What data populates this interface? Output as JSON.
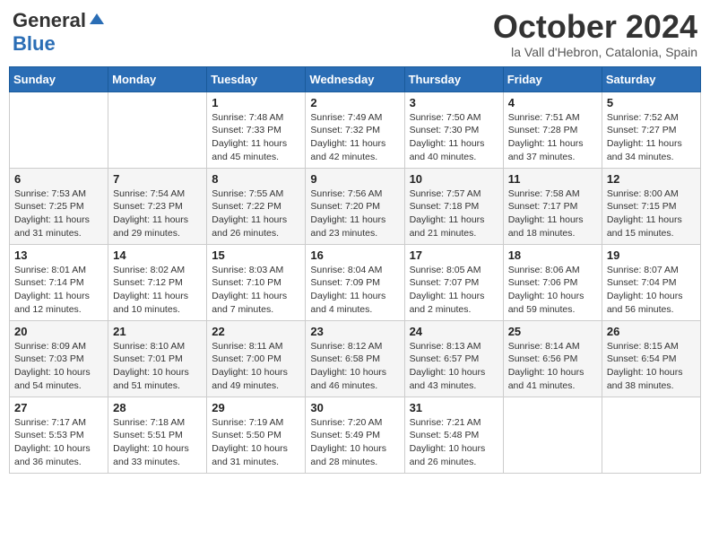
{
  "logo": {
    "general": "General",
    "blue": "Blue"
  },
  "title": "October 2024",
  "location": "la Vall d'Hebron, Catalonia, Spain",
  "headers": [
    "Sunday",
    "Monday",
    "Tuesday",
    "Wednesday",
    "Thursday",
    "Friday",
    "Saturday"
  ],
  "weeks": [
    [
      {
        "day": "",
        "info": ""
      },
      {
        "day": "",
        "info": ""
      },
      {
        "day": "1",
        "info": "Sunrise: 7:48 AM\nSunset: 7:33 PM\nDaylight: 11 hours and 45 minutes."
      },
      {
        "day": "2",
        "info": "Sunrise: 7:49 AM\nSunset: 7:32 PM\nDaylight: 11 hours and 42 minutes."
      },
      {
        "day": "3",
        "info": "Sunrise: 7:50 AM\nSunset: 7:30 PM\nDaylight: 11 hours and 40 minutes."
      },
      {
        "day": "4",
        "info": "Sunrise: 7:51 AM\nSunset: 7:28 PM\nDaylight: 11 hours and 37 minutes."
      },
      {
        "day": "5",
        "info": "Sunrise: 7:52 AM\nSunset: 7:27 PM\nDaylight: 11 hours and 34 minutes."
      }
    ],
    [
      {
        "day": "6",
        "info": "Sunrise: 7:53 AM\nSunset: 7:25 PM\nDaylight: 11 hours and 31 minutes."
      },
      {
        "day": "7",
        "info": "Sunrise: 7:54 AM\nSunset: 7:23 PM\nDaylight: 11 hours and 29 minutes."
      },
      {
        "day": "8",
        "info": "Sunrise: 7:55 AM\nSunset: 7:22 PM\nDaylight: 11 hours and 26 minutes."
      },
      {
        "day": "9",
        "info": "Sunrise: 7:56 AM\nSunset: 7:20 PM\nDaylight: 11 hours and 23 minutes."
      },
      {
        "day": "10",
        "info": "Sunrise: 7:57 AM\nSunset: 7:18 PM\nDaylight: 11 hours and 21 minutes."
      },
      {
        "day": "11",
        "info": "Sunrise: 7:58 AM\nSunset: 7:17 PM\nDaylight: 11 hours and 18 minutes."
      },
      {
        "day": "12",
        "info": "Sunrise: 8:00 AM\nSunset: 7:15 PM\nDaylight: 11 hours and 15 minutes."
      }
    ],
    [
      {
        "day": "13",
        "info": "Sunrise: 8:01 AM\nSunset: 7:14 PM\nDaylight: 11 hours and 12 minutes."
      },
      {
        "day": "14",
        "info": "Sunrise: 8:02 AM\nSunset: 7:12 PM\nDaylight: 11 hours and 10 minutes."
      },
      {
        "day": "15",
        "info": "Sunrise: 8:03 AM\nSunset: 7:10 PM\nDaylight: 11 hours and 7 minutes."
      },
      {
        "day": "16",
        "info": "Sunrise: 8:04 AM\nSunset: 7:09 PM\nDaylight: 11 hours and 4 minutes."
      },
      {
        "day": "17",
        "info": "Sunrise: 8:05 AM\nSunset: 7:07 PM\nDaylight: 11 hours and 2 minutes."
      },
      {
        "day": "18",
        "info": "Sunrise: 8:06 AM\nSunset: 7:06 PM\nDaylight: 10 hours and 59 minutes."
      },
      {
        "day": "19",
        "info": "Sunrise: 8:07 AM\nSunset: 7:04 PM\nDaylight: 10 hours and 56 minutes."
      }
    ],
    [
      {
        "day": "20",
        "info": "Sunrise: 8:09 AM\nSunset: 7:03 PM\nDaylight: 10 hours and 54 minutes."
      },
      {
        "day": "21",
        "info": "Sunrise: 8:10 AM\nSunset: 7:01 PM\nDaylight: 10 hours and 51 minutes."
      },
      {
        "day": "22",
        "info": "Sunrise: 8:11 AM\nSunset: 7:00 PM\nDaylight: 10 hours and 49 minutes."
      },
      {
        "day": "23",
        "info": "Sunrise: 8:12 AM\nSunset: 6:58 PM\nDaylight: 10 hours and 46 minutes."
      },
      {
        "day": "24",
        "info": "Sunrise: 8:13 AM\nSunset: 6:57 PM\nDaylight: 10 hours and 43 minutes."
      },
      {
        "day": "25",
        "info": "Sunrise: 8:14 AM\nSunset: 6:56 PM\nDaylight: 10 hours and 41 minutes."
      },
      {
        "day": "26",
        "info": "Sunrise: 8:15 AM\nSunset: 6:54 PM\nDaylight: 10 hours and 38 minutes."
      }
    ],
    [
      {
        "day": "27",
        "info": "Sunrise: 7:17 AM\nSunset: 5:53 PM\nDaylight: 10 hours and 36 minutes."
      },
      {
        "day": "28",
        "info": "Sunrise: 7:18 AM\nSunset: 5:51 PM\nDaylight: 10 hours and 33 minutes."
      },
      {
        "day": "29",
        "info": "Sunrise: 7:19 AM\nSunset: 5:50 PM\nDaylight: 10 hours and 31 minutes."
      },
      {
        "day": "30",
        "info": "Sunrise: 7:20 AM\nSunset: 5:49 PM\nDaylight: 10 hours and 28 minutes."
      },
      {
        "day": "31",
        "info": "Sunrise: 7:21 AM\nSunset: 5:48 PM\nDaylight: 10 hours and 26 minutes."
      },
      {
        "day": "",
        "info": ""
      },
      {
        "day": "",
        "info": ""
      }
    ]
  ]
}
